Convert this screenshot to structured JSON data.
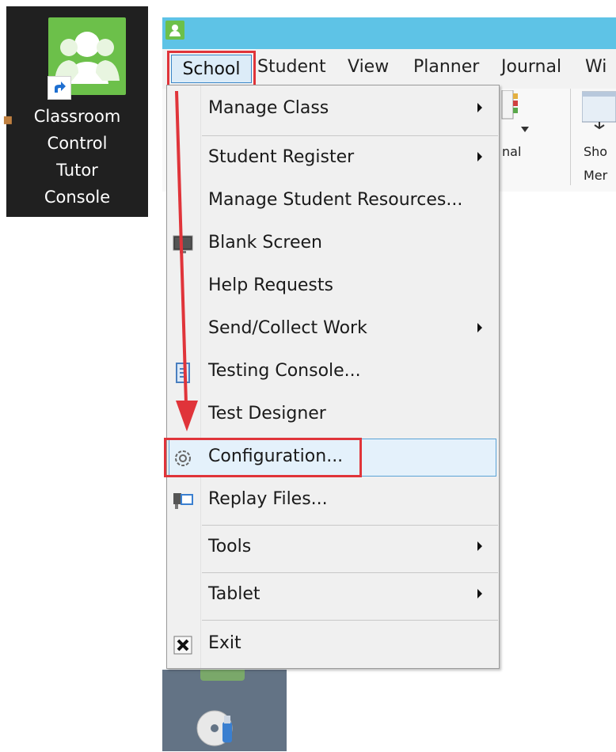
{
  "desktop": {
    "shortcut_label_lines": [
      "Classroom",
      "Control",
      "Tutor",
      "Console"
    ]
  },
  "menubar": {
    "items": [
      "School",
      "Student",
      "View",
      "Planner",
      "Journal",
      "Wi"
    ]
  },
  "ribbon": {
    "partial_labels": [
      "nal",
      "Sho",
      "Mer"
    ]
  },
  "school_menu": {
    "items": [
      {
        "label": "Manage Class",
        "submenu": true,
        "icon": ""
      },
      {
        "label": "Student Register",
        "submenu": true,
        "icon": ""
      },
      {
        "label": "Manage Student Resources...",
        "submenu": false,
        "icon": ""
      },
      {
        "label": "Blank Screen",
        "submenu": false,
        "icon": "monitor-icon"
      },
      {
        "label": "Help Requests",
        "submenu": false,
        "icon": ""
      },
      {
        "label": "Send/Collect Work",
        "submenu": true,
        "icon": ""
      },
      {
        "label": "Testing Console...",
        "submenu": false,
        "icon": "document-icon"
      },
      {
        "label": "Test Designer",
        "submenu": false,
        "icon": ""
      },
      {
        "label": "Configuration...",
        "submenu": false,
        "icon": "gear-icon"
      },
      {
        "label": "Replay Files...",
        "submenu": false,
        "icon": "camera-icon"
      },
      {
        "label": "Tools",
        "submenu": true,
        "icon": ""
      },
      {
        "label": "Tablet",
        "submenu": true,
        "icon": ""
      },
      {
        "label": "Exit",
        "submenu": false,
        "icon": "close-icon"
      }
    ]
  },
  "colors": {
    "annotation_red": "#e0343a",
    "titlebar": "#5ec3e6",
    "highlight_border": "#5aa3d6"
  }
}
